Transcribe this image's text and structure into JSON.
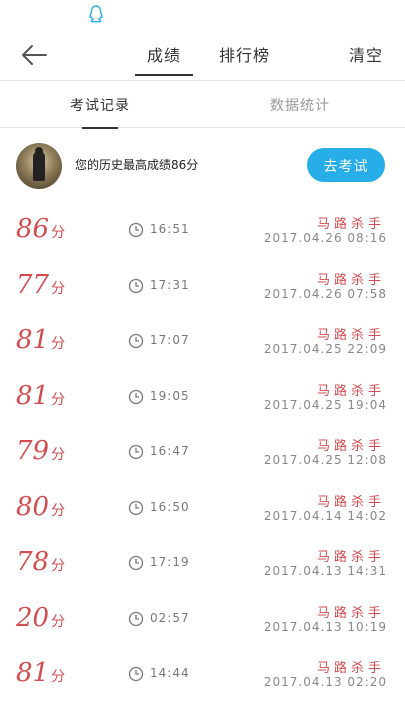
{
  "topbar": {
    "tabs": [
      {
        "label": "成绩"
      },
      {
        "label": "排行榜"
      }
    ],
    "clear_label": "清空"
  },
  "subtabs": [
    {
      "label": "考试记录"
    },
    {
      "label": "数据统计"
    }
  ],
  "best": {
    "text": "您的历史最高成绩86分",
    "button_label": "去考试"
  },
  "records": [
    {
      "score": "86",
      "unit": "分",
      "duration": "16:51",
      "name": "马路杀手",
      "date": "2017.04.26  08:16"
    },
    {
      "score": "77",
      "unit": "分",
      "duration": "17:31",
      "name": "马路杀手",
      "date": "2017.04.26  07:58"
    },
    {
      "score": "81",
      "unit": "分",
      "duration": "17:07",
      "name": "马路杀手",
      "date": "2017.04.25  22:09"
    },
    {
      "score": "81",
      "unit": "分",
      "duration": "19:05",
      "name": "马路杀手",
      "date": "2017.04.25  19:04"
    },
    {
      "score": "79",
      "unit": "分",
      "duration": "16:47",
      "name": "马路杀手",
      "date": "2017.04.25  12:08"
    },
    {
      "score": "80",
      "unit": "分",
      "duration": "16:50",
      "name": "马路杀手",
      "date": "2017.04.14  14:02"
    },
    {
      "score": "78",
      "unit": "分",
      "duration": "17:19",
      "name": "马路杀手",
      "date": "2017.04.13  14:31"
    },
    {
      "score": "20",
      "unit": "分",
      "duration": "02:57",
      "name": "马路杀手",
      "date": "2017.04.13  10:19"
    },
    {
      "score": "81",
      "unit": "分",
      "duration": "14:44",
      "name": "马路杀手",
      "date": "2017.04.13  02:20"
    }
  ],
  "colors": {
    "accent": "#27aee8",
    "score": "#d24d4f"
  }
}
